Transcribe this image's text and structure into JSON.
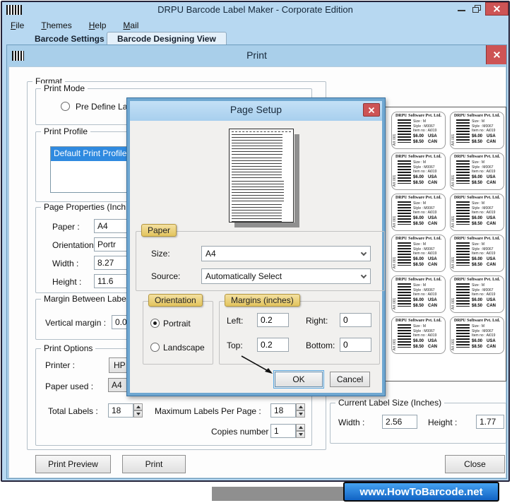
{
  "window": {
    "title": "DRPU Barcode Label Maker - Corporate Edition",
    "menu": [
      "File",
      "Themes",
      "Help",
      "Mail"
    ],
    "tabs": [
      {
        "label": "Barcode Settings",
        "active": false
      },
      {
        "label": "Barcode Designing View",
        "active": true
      }
    ]
  },
  "print_dialog": {
    "title": "Print",
    "format": {
      "label": "Format",
      "print_mode": {
        "label": "Print Mode",
        "radio_label": "Pre Define Lab"
      },
      "print_profile": {
        "label": "Print Profile",
        "selected_item": "Default Print Profile"
      },
      "page_properties": {
        "label": "Page Properties (Inch",
        "rows": [
          {
            "label": "Paper :",
            "value": "A4"
          },
          {
            "label": "Orientation :",
            "value": "Portr"
          },
          {
            "label": "Width :",
            "value": "8.27"
          },
          {
            "label": "Height :",
            "value": "11.6"
          }
        ]
      },
      "margin_between_labels": {
        "label": "Margin Between Label",
        "row_label": "Vertical margin :",
        "value": "0.0"
      },
      "print_options": {
        "label": "Print Options",
        "printer_label": "Printer :",
        "printer_value": "HP La",
        "paper_used_label": "Paper used :",
        "paper_used_value": "A4",
        "total_labels_label": "Total Labels :",
        "total_labels_value": "18",
        "max_labels_label": "Maximum Labels Per Page :",
        "max_labels_value": "18",
        "copies_label": "Copies number :",
        "copies_value": "1"
      }
    },
    "current_label_size": {
      "label": "Current Label Size (Inches)",
      "width_label": "Width :",
      "width_value": "2.56",
      "height_label": "Height :",
      "height_value": "1.77"
    },
    "buttons": {
      "print_preview": "Print Preview",
      "print": "Print",
      "close": "Close"
    }
  },
  "page_setup": {
    "title": "Page Setup",
    "paper": {
      "label": "Paper",
      "size_label": "Size:",
      "size_value": "A4",
      "source_label": "Source:",
      "source_value": "Automatically Select"
    },
    "orientation": {
      "label": "Orientation",
      "options": [
        {
          "label": "Portrait",
          "selected": true
        },
        {
          "label": "Landscape",
          "selected": false
        }
      ]
    },
    "margins": {
      "label": "Margins (inches)",
      "fields": [
        {
          "label": "Left:",
          "value": "0.2"
        },
        {
          "label": "Right:",
          "value": "0"
        },
        {
          "label": "Top:",
          "value": "0.2"
        },
        {
          "label": "Bottom:",
          "value": "0"
        }
      ]
    },
    "buttons": {
      "ok": "OK",
      "cancel": "Cancel"
    }
  },
  "label_preview": {
    "count": 12,
    "card": {
      "company": "DRPU Software Pvt. Ltd.",
      "barcode_text": "AX 001",
      "size_label": "Size :",
      "size": "M",
      "style_label": "Style :",
      "style": "M0067",
      "item_label": "Item no :",
      "item": "Ai019",
      "price_usa": "$6.00",
      "usa": "USA",
      "price_can": "$8.50",
      "can": "CAN"
    }
  },
  "watermark": "www.HowToBarcode.net",
  "colors": {
    "window_blue": "#b7d8f1",
    "dialog_header_blue": "#a9cfea",
    "page_setup_frame": "#6fa7d1",
    "close_red": "#cd5455",
    "selection_blue": "#2f8ae0",
    "group_tag_yellow": "#e8cf7a",
    "watermark_blue": "#1163c4"
  }
}
